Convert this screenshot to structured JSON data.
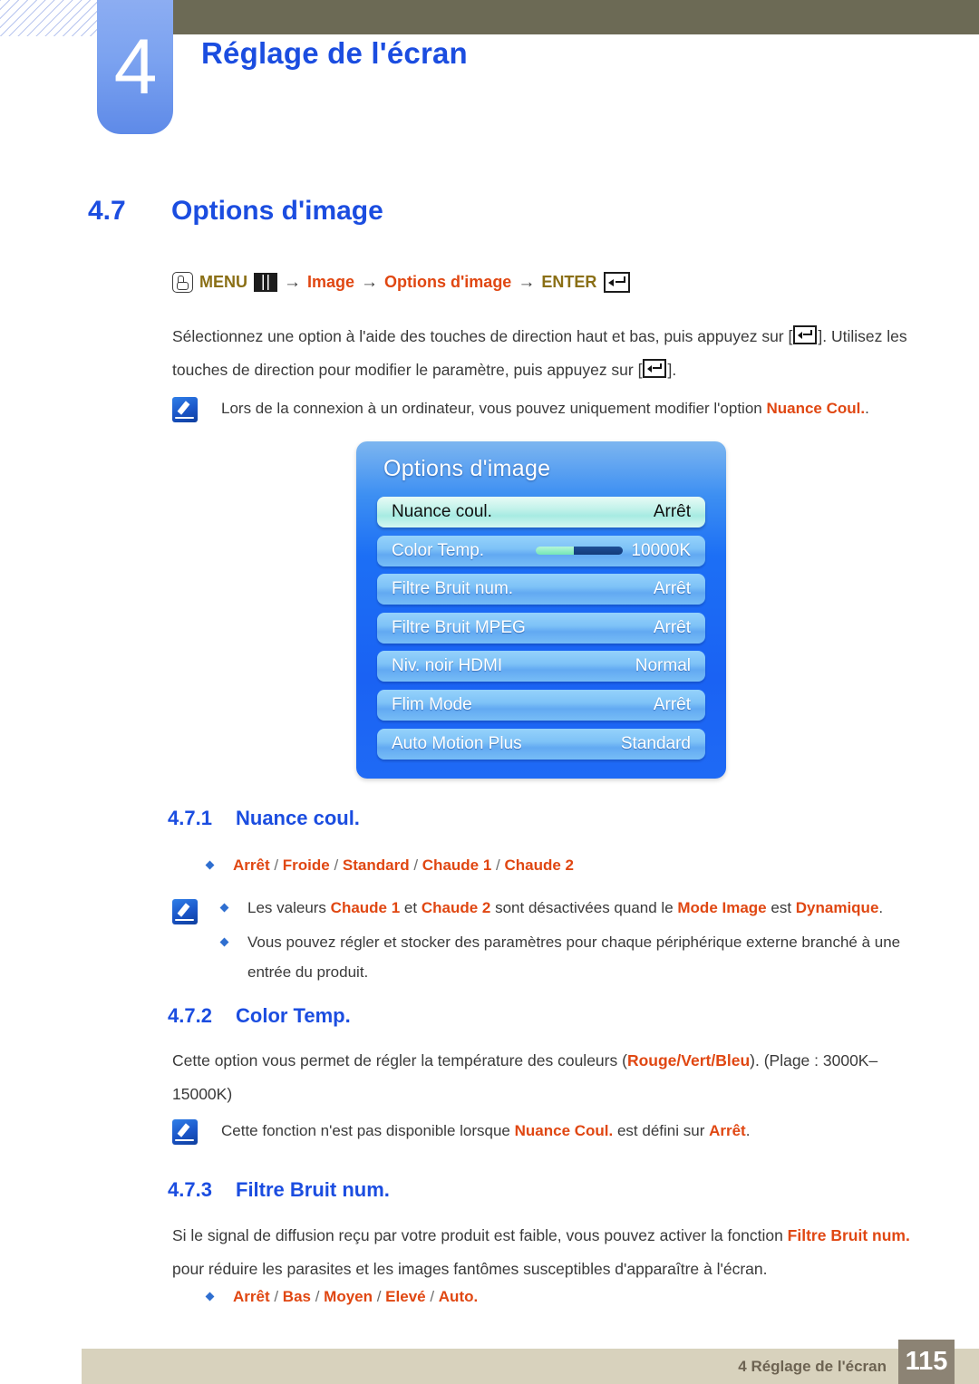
{
  "header": {
    "chapter_number": "4",
    "chapter_title": "Réglage de l'écran"
  },
  "section": {
    "number": "4.7",
    "title": "Options d'image"
  },
  "breadcrumb": {
    "mouse_icon": "hand-press-icon",
    "menu_label": "MENU",
    "menu_icon": "menu-grid-icon",
    "arrow1": "→",
    "item1": "Image",
    "arrow2": "→",
    "item2": "Options d'image",
    "arrow3": "→",
    "enter_label": "ENTER",
    "enter_icon": "enter-return-icon"
  },
  "intro": {
    "line1_a": "Sélectionnez une option à l'aide des touches de direction haut et bas, puis appuyez sur [",
    "line1_b": "]. Utilisez les",
    "line2_a": "touches de direction pour modifier le paramètre, puis appuyez sur [",
    "line2_b": "]."
  },
  "note_top": {
    "icon": "note-pen-icon",
    "text_a": "Lors de la connexion à un ordinateur, vous pouvez uniquement modifier l'option ",
    "highlight": "Nuance Coul.",
    "text_b": "."
  },
  "osd": {
    "title": "Options d'image",
    "rows": [
      {
        "label": "Nuance coul.",
        "value": "Arrêt",
        "selected": true,
        "slider": false
      },
      {
        "label": "Color Temp.",
        "value": "10000K",
        "selected": false,
        "slider": true,
        "slider_percent": 43
      },
      {
        "label": "Filtre Bruit num.",
        "value": "Arrêt",
        "selected": false,
        "slider": false
      },
      {
        "label": "Filtre Bruit MPEG",
        "value": "Arrêt",
        "selected": false,
        "slider": false
      },
      {
        "label": "Niv. noir HDMI",
        "value": "Normal",
        "selected": false,
        "slider": false
      },
      {
        "label": "Flim Mode",
        "value": "Arrêt",
        "selected": false,
        "slider": false
      },
      {
        "label": "Auto Motion Plus",
        "value": "Standard",
        "selected": false,
        "slider": false
      }
    ]
  },
  "sub471": {
    "number": "4.7.1",
    "title": "Nuance coul.",
    "options": [
      {
        "text": "Arrêt",
        "sep": " / "
      },
      {
        "text": "Froide",
        "sep": " / "
      },
      {
        "text": "Standard",
        "sep": " / "
      },
      {
        "text": "Chaude 1",
        "sep": " / "
      },
      {
        "text": "Chaude 2",
        "sep": ""
      }
    ],
    "note_icon": "note-pen-icon",
    "note1_a": "Les valeurs ",
    "note1_h1": "Chaude 1",
    "note1_b": " et ",
    "note1_h2": "Chaude 2",
    "note1_c": " sont désactivées quand le ",
    "note1_h3": "Mode Image",
    "note1_d": " est ",
    "note1_h4": "Dynamique",
    "note1_e": ".",
    "note2": "Vous pouvez régler et stocker des paramètres pour chaque périphérique externe branché à une entrée du produit."
  },
  "sub472": {
    "number": "4.7.2",
    "title": "Color Temp.",
    "para_a": "Cette option vous permet de régler la température des couleurs (",
    "para_h1": "Rouge",
    "para_s1": "/",
    "para_h2": "Vert",
    "para_s2": "/",
    "para_h3": "Bleu",
    "para_b": "). (Plage : 3000K–15000K)",
    "note_icon": "note-pen-icon",
    "note_a": "Cette fonction n'est pas disponible lorsque ",
    "note_h1": "Nuance Coul.",
    "note_b": " est défini sur ",
    "note_h2": "Arrêt",
    "note_c": "."
  },
  "sub473": {
    "number": "4.7.3",
    "title": "Filtre Bruit num.",
    "para_a": "Si le signal de diffusion reçu par votre produit est faible, vous pouvez activer la fonction ",
    "para_h1": "Filtre Bruit num.",
    "para_b": " pour réduire les parasites et les images fantômes susceptibles d'apparaître à l'écran.",
    "options": [
      {
        "text": "Arrêt",
        "sep": " / "
      },
      {
        "text": "Bas",
        "sep": " / "
      },
      {
        "text": "Moyen",
        "sep": " / "
      },
      {
        "text": "Elevé",
        "sep": " / "
      },
      {
        "text": "Auto.",
        "sep": ""
      }
    ]
  },
  "footer": {
    "text": "4 Réglage de l'écran",
    "page": "115"
  },
  "colors": {
    "accent_blue": "#1b4de0",
    "highlight_orange": "#e04712",
    "olive_band": "#6c6a55",
    "breadcrumb_olive": "#8a6f15",
    "footer_bar": "#d8d2bd",
    "footer_page_bg": "#8c8374",
    "osd_blue": "#1c6ff5"
  }
}
